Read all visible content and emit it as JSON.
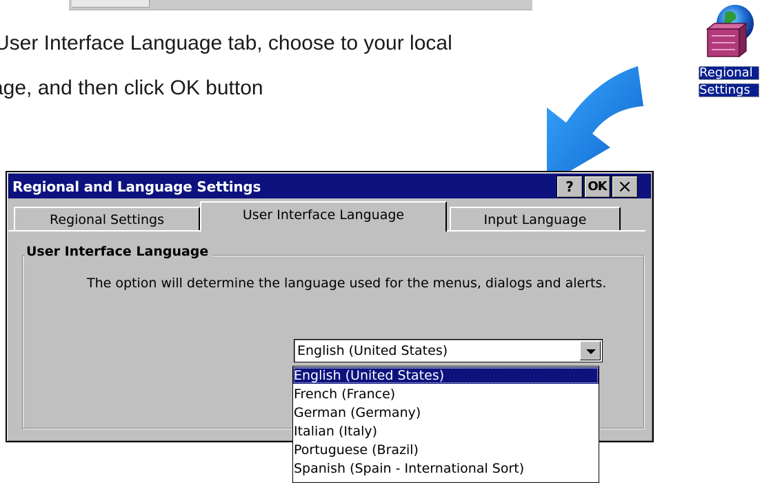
{
  "instructions": {
    "line1": "User Interface Language tab, choose to your local",
    "line2": "age, and then click OK button"
  },
  "desktop_icon": {
    "icon": "regional-settings-globe-icon",
    "label_line1": "Regional",
    "label_line2": "Settings"
  },
  "dialog": {
    "title": "Regional and Language Settings",
    "help_label": "?",
    "ok_label": "OK",
    "close_label": "×",
    "tabs": [
      {
        "label": "Regional Settings",
        "active": false
      },
      {
        "label": "User Interface Language",
        "active": true
      },
      {
        "label": "Input Language",
        "active": false
      }
    ],
    "group_title": "User Interface Language",
    "description": "The option will determine the language used for the menus, dialogs and alerts.",
    "language_select": {
      "value": "English (United States)",
      "options": [
        "English (United States)",
        "French (France)",
        "German (Germany)",
        "Italian (Italy)",
        "Portuguese (Brazil)",
        "Spanish (Spain - International Sort)"
      ],
      "highlighted": "English (United States)"
    }
  },
  "colors": {
    "titlebar": "#0d127f",
    "dialog_face": "#c0c0c0",
    "arrow": "#1e7fe0"
  }
}
